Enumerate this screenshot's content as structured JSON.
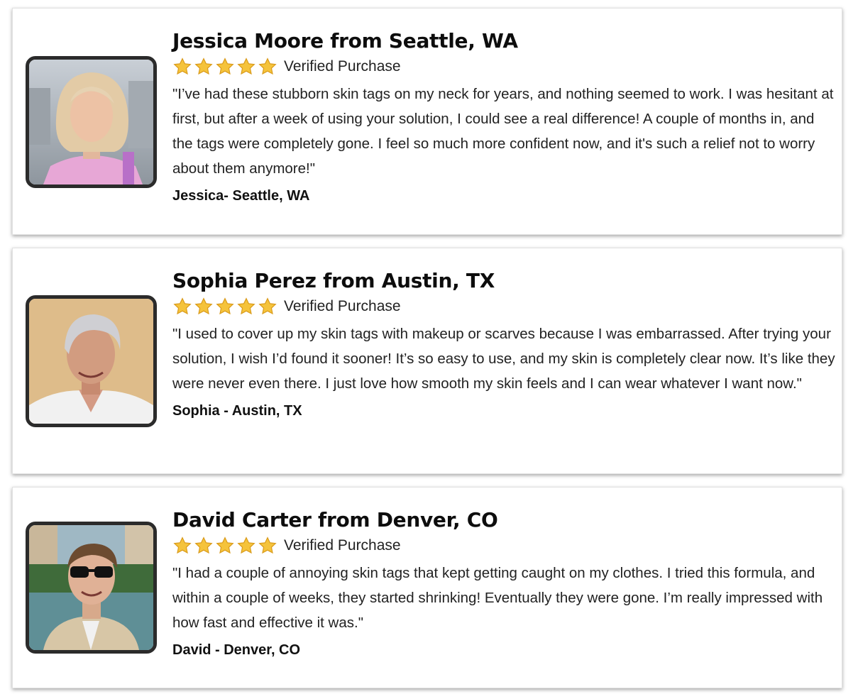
{
  "reviews": [
    {
      "title": "Jessica Moore from Seattle, WA",
      "verified": "Verified Purchase",
      "rating": 5,
      "quote": "\"I’ve had these stubborn skin tags on my neck for years, and nothing seemed to work. I was hesitant at first, but after a week of using your solution, I could see a real difference! A couple of months in, and the tags were completely gone. I feel so much more confident now, and it's such a relief not to worry about them anymore!\"",
      "signature": "Jessica- Seattle, WA"
    },
    {
      "title": "Sophia Perez from Austin, TX",
      "verified": "Verified Purchase",
      "rating": 5,
      "quote": "\"I used to cover up my skin tags with makeup or scarves because I was embarrassed. After trying your solution, I wish I’d found it sooner! It’s so easy to use, and my skin is completely clear now. It’s like they were never even there. I just love how smooth my skin feels and I can wear whatever I want now.\"",
      "signature": "Sophia - Austin, TX"
    },
    {
      "title": "David Carter from Denver, CO",
      "verified": "Verified Purchase",
      "rating": 5,
      "quote": "\"I had a couple of annoying skin tags that kept getting caught on my clothes. I tried this formula, and within a couple of weeks, they started shrinking! Eventually they were gone. I’m really impressed with how fast and effective it was.\"",
      "signature": "David - Denver, CO"
    }
  ],
  "colors": {
    "star_fill": "#f5c33b",
    "star_stroke": "#d99a1a",
    "photo_border": "#2b2b2b"
  }
}
